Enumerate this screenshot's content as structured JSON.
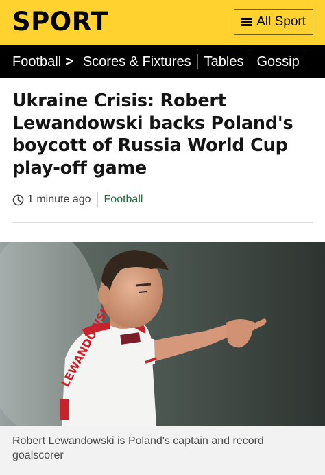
{
  "header": {
    "brand": "SPORT",
    "menu_label": "All Sport",
    "bg_color": "#ffd230"
  },
  "nav": {
    "items": [
      {
        "label": "Football"
      },
      {
        "label": "Scores & Fixtures"
      },
      {
        "label": "Tables"
      },
      {
        "label": "Gossip"
      }
    ],
    "chevron": ">"
  },
  "article": {
    "headline": "Ukraine Crisis: Robert Lewandowski backs Poland's boycott of Russia World Cup play-off game",
    "timestamp": "1 minute ago",
    "topic": "Football",
    "topic_color": "#1a6a3b"
  },
  "image": {
    "icon": "photo-player-pointing",
    "shirt_text": "LEWANDOWSKI",
    "caption": "Robert Lewandowski is Poland's captain and record goalscorer"
  }
}
